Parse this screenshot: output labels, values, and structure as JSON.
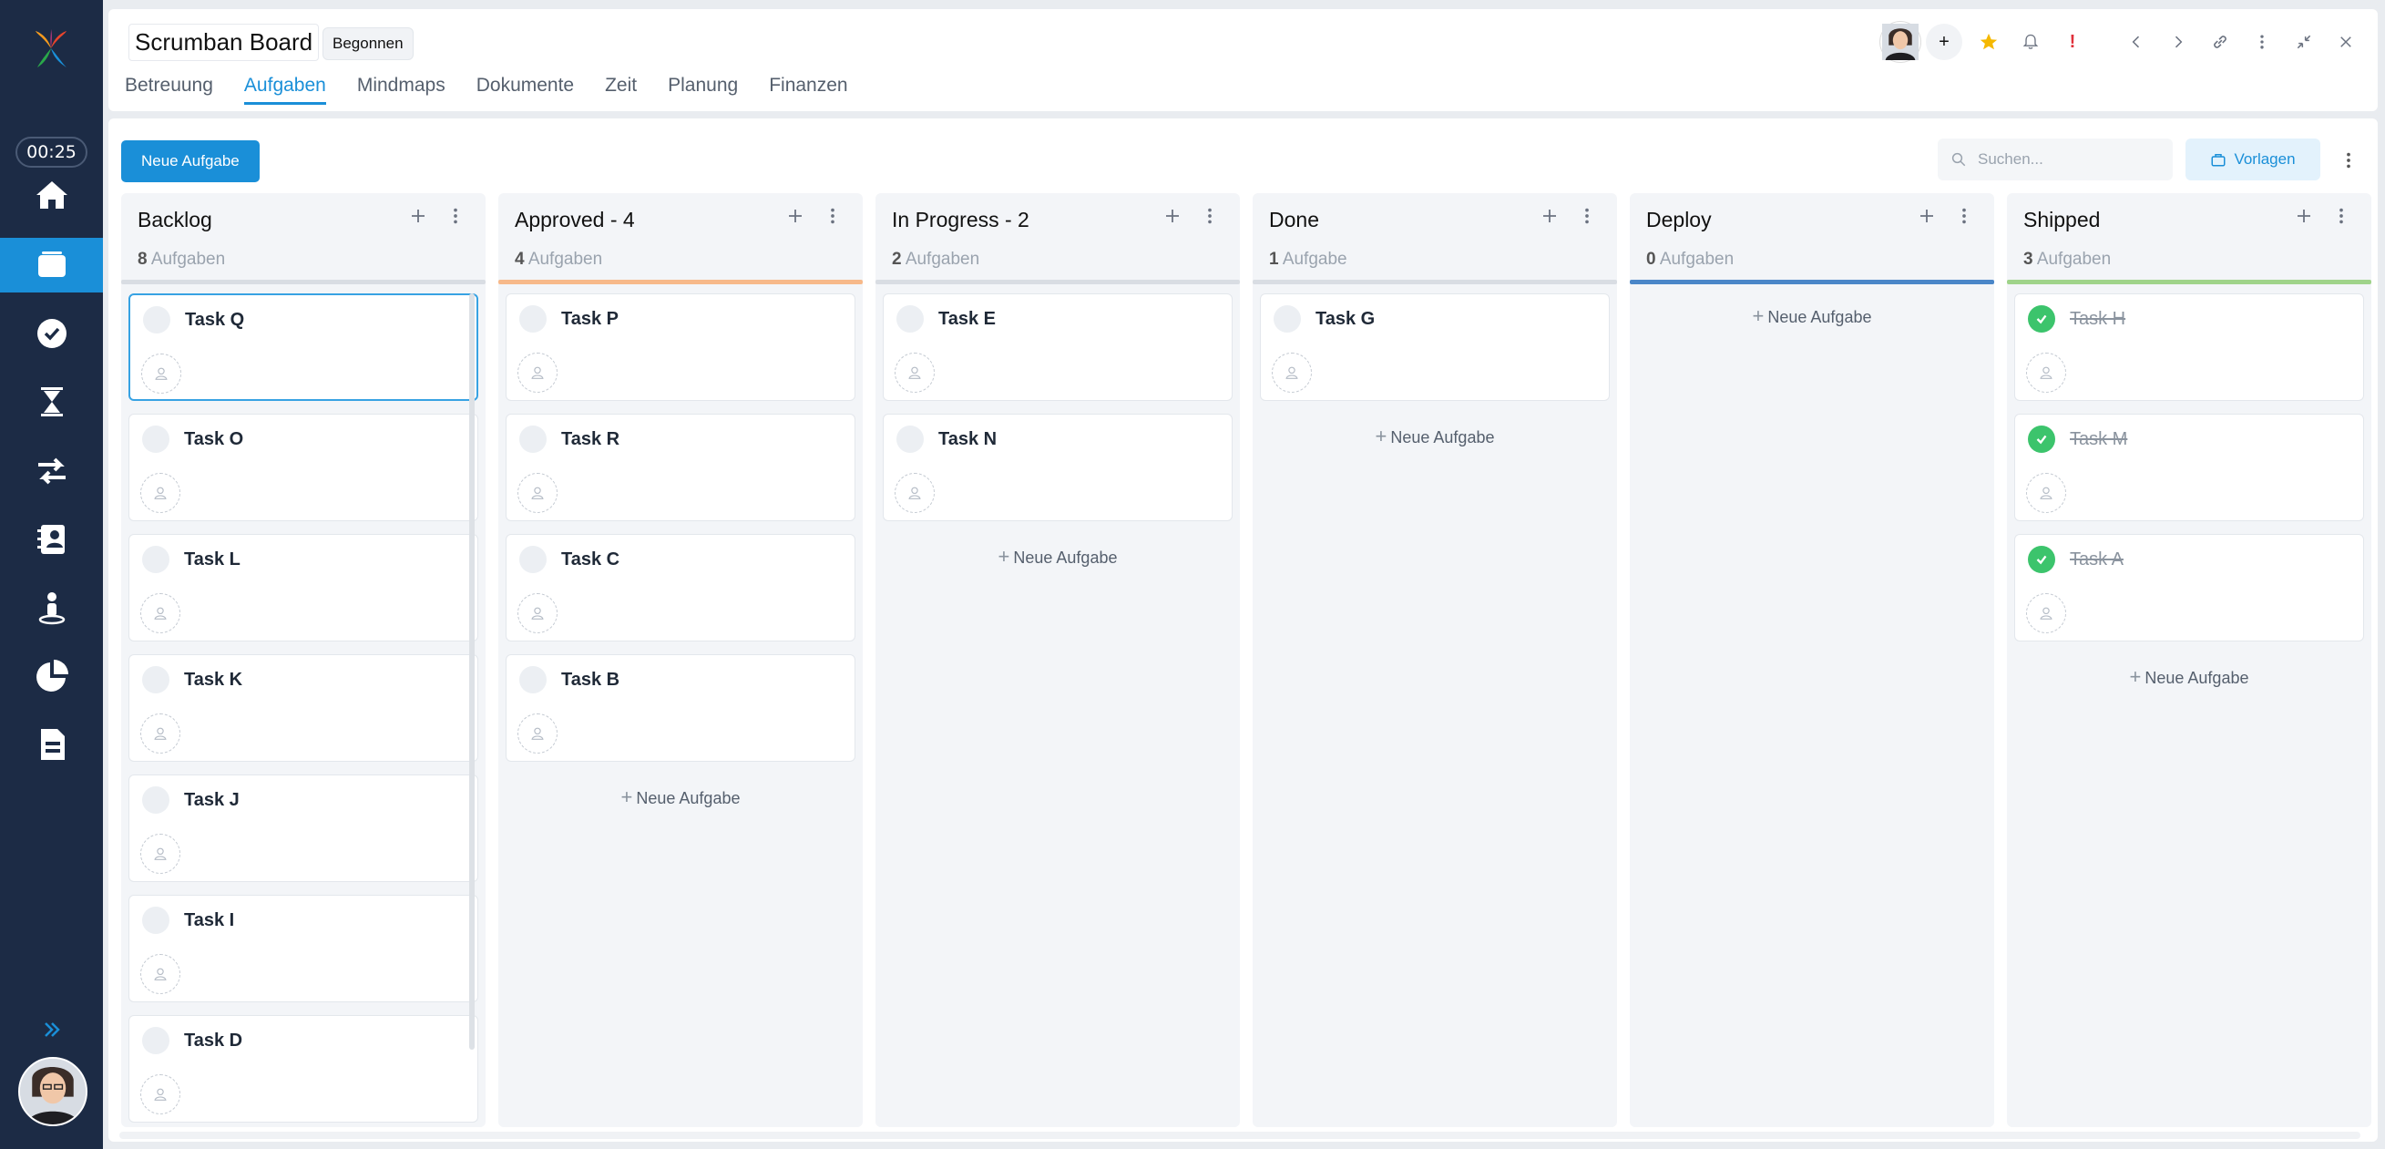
{
  "sidebar": {
    "timer": "00:25",
    "items": [
      {
        "icon": "home-icon"
      },
      {
        "icon": "projects-icon",
        "active": true
      },
      {
        "icon": "check-icon"
      },
      {
        "icon": "hourglass-icon"
      },
      {
        "icon": "transfer-icon"
      },
      {
        "icon": "contacts-icon"
      },
      {
        "icon": "person-icon"
      },
      {
        "icon": "pie-chart-icon"
      },
      {
        "icon": "document-icon"
      }
    ]
  },
  "header": {
    "title": "Scrumban Board",
    "status": "Begonnen",
    "tabs": [
      {
        "label": "Betreuung"
      },
      {
        "label": "Aufgaben",
        "active": true
      },
      {
        "label": "Mindmaps"
      },
      {
        "label": "Dokumente"
      },
      {
        "label": "Zeit"
      },
      {
        "label": "Planung"
      },
      {
        "label": "Finanzen"
      }
    ],
    "add_symbol": "+",
    "alert_symbol": "!"
  },
  "toolbar": {
    "new_task": "Neue Aufgabe",
    "search_placeholder": "Suchen...",
    "templates": "Vorlagen"
  },
  "add_task_label": "Neue Aufgabe",
  "columns": [
    {
      "title": "Backlog",
      "count": "8",
      "count_label": "Aufgaben",
      "bar_color": "#d9dde3",
      "tasks": [
        "Task Q",
        "Task O",
        "Task L",
        "Task K",
        "Task J",
        "Task I",
        "Task D"
      ]
    },
    {
      "title": "Approved - 4",
      "count": "4",
      "count_label": "Aufgaben",
      "bar_color": "#f7b98a",
      "tasks": [
        "Task P",
        "Task R",
        "Task C",
        "Task B"
      ]
    },
    {
      "title": "In Progress - 2",
      "count": "2",
      "count_label": "Aufgaben",
      "bar_color": "#d9dde3",
      "tasks": [
        "Task E",
        "Task N"
      ]
    },
    {
      "title": "Done",
      "count": "1",
      "count_label": "Aufgabe",
      "bar_color": "#d9dde3",
      "tasks": [
        "Task G"
      ]
    },
    {
      "title": "Deploy",
      "count": "0",
      "count_label": "Aufgaben",
      "bar_color": "#4a86c8",
      "tasks": []
    },
    {
      "title": "Shipped",
      "count": "3",
      "count_label": "Aufgaben",
      "bar_color": "#9fd38a",
      "tasks": [
        "Task H",
        "Task M",
        "Task A"
      ],
      "completed": true
    }
  ],
  "colors": {
    "accent": "#1a8fd8",
    "sidebar": "#1c2b45",
    "done": "#3cc46c",
    "star": "#f5b800",
    "alert": "#e0303a"
  }
}
